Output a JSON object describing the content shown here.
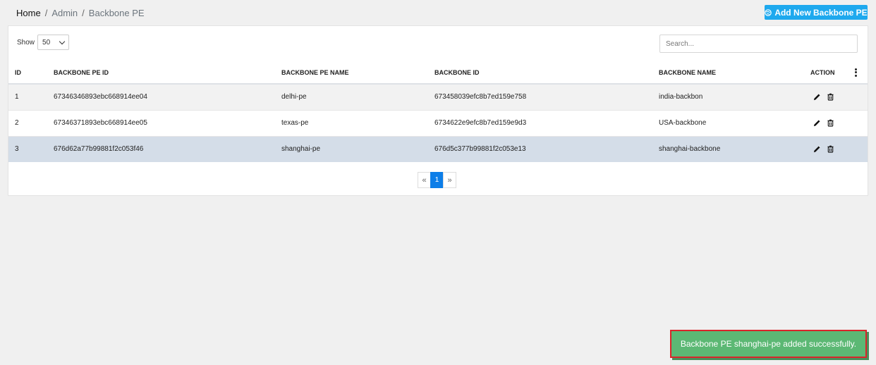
{
  "breadcrumb": {
    "home": "Home",
    "admin": "Admin",
    "current": "Backbone PE",
    "separator": "/"
  },
  "header": {
    "add_button_label": "Add New Backbone PE",
    "add_button_icon": "globe-icon",
    "add_button_color": "#1ea9ee"
  },
  "controls": {
    "show_label": "Show",
    "page_size": "50",
    "search_placeholder": "Search..."
  },
  "table": {
    "columns": [
      "ID",
      "BACKBONE PE ID",
      "BACKBONE PE NAME",
      "BACKBONE ID",
      "BACKBONE NAME",
      "ACTION"
    ],
    "rows": [
      {
        "id": "1",
        "pe_id": "67346346893ebc668914ee04",
        "pe_name": "delhi-pe",
        "backbone_id": "673458039efc8b7ed159e758",
        "backbone_name": "india-backbon"
      },
      {
        "id": "2",
        "pe_id": "67346371893ebc668914ee05",
        "pe_name": "texas-pe",
        "backbone_id": "6734622e9efc8b7ed159e9d3",
        "backbone_name": "USA-backbone"
      },
      {
        "id": "3",
        "pe_id": "676d62a77b99881f2c053f46",
        "pe_name": "shanghai-pe",
        "backbone_id": "676d5c377b99881f2c053e13",
        "backbone_name": "shanghai-backbone"
      }
    ]
  },
  "pagination": {
    "prev": "«",
    "current": "1",
    "next": "»"
  },
  "toast": {
    "message": "Backbone PE shanghai-pe added successfully.",
    "color": "#5cb874"
  }
}
